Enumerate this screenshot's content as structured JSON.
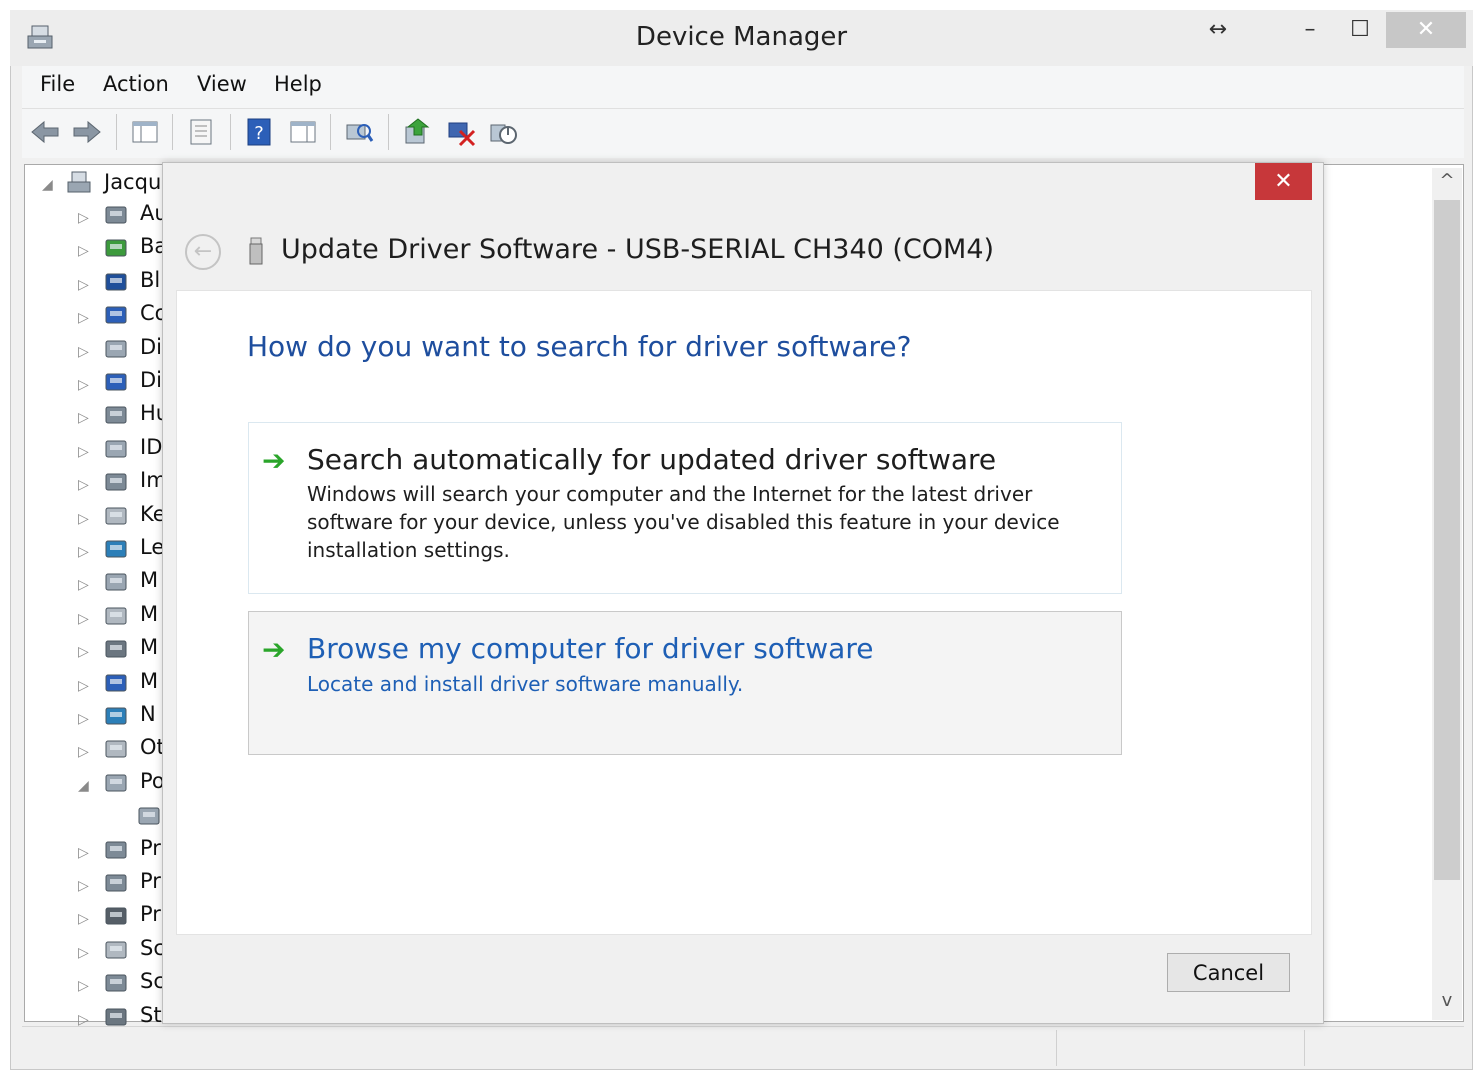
{
  "window": {
    "title": "Device Manager",
    "controls": {
      "resize": "↔",
      "minimize": "–",
      "maximize": "☐",
      "close": "✕"
    }
  },
  "menu": [
    "File",
    "Action",
    "View",
    "Help"
  ],
  "tree": {
    "root": "Jacqu",
    "items": [
      {
        "label": "Au",
        "icon": "speaker-icon",
        "expanded": false
      },
      {
        "label": "Ba",
        "icon": "battery-icon",
        "expanded": false
      },
      {
        "label": "Bl",
        "icon": "bluetooth-icon",
        "expanded": false
      },
      {
        "label": "Co",
        "icon": "computer-icon",
        "expanded": false
      },
      {
        "label": "Di",
        "icon": "disk-drive-icon",
        "expanded": false
      },
      {
        "label": "Di",
        "icon": "display-adapter-icon",
        "expanded": false
      },
      {
        "label": "Hu",
        "icon": "hid-icon",
        "expanded": false
      },
      {
        "label": "ID",
        "icon": "ide-controller-icon",
        "expanded": false
      },
      {
        "label": "Im",
        "icon": "imaging-device-icon",
        "expanded": false
      },
      {
        "label": "Ke",
        "icon": "keyboard-icon",
        "expanded": false
      },
      {
        "label": "Le",
        "icon": "network-legacy-icon",
        "expanded": false
      },
      {
        "label": "M",
        "icon": "memory-device-icon",
        "expanded": false
      },
      {
        "label": "M",
        "icon": "mouse-icon",
        "expanded": false
      },
      {
        "label": "M",
        "icon": "microphone-icon",
        "expanded": false
      },
      {
        "label": "M",
        "icon": "monitor-icon",
        "expanded": false
      },
      {
        "label": "N",
        "icon": "network-adapter-icon",
        "expanded": false
      },
      {
        "label": "Ot",
        "icon": "other-device-icon",
        "expanded": false
      },
      {
        "label": "Po",
        "icon": "ports-icon",
        "expanded": true
      },
      {
        "label": "",
        "icon": "port-child-icon",
        "expanded": null
      },
      {
        "label": "Pr",
        "icon": "printer-icon",
        "expanded": false
      },
      {
        "label": "Pr",
        "icon": "print-queue-icon",
        "expanded": false
      },
      {
        "label": "Pr",
        "icon": "processor-icon",
        "expanded": false
      },
      {
        "label": "Sc",
        "icon": "usb-device-icon",
        "expanded": false
      },
      {
        "label": "Sc",
        "icon": "sound-icon",
        "expanded": false
      },
      {
        "label": "St",
        "icon": "storage-icon",
        "expanded": false
      }
    ]
  },
  "dialog": {
    "close": "✕",
    "back": "←",
    "title": "Update Driver Software - USB-SERIAL CH340 (COM4)",
    "question": "How do you want to search for driver software?",
    "options": {
      "auto": {
        "arrow": "➔",
        "title": "Search automatically for updated driver software",
        "desc": "Windows will search your computer and the Internet for the latest driver software for your device, unless you've disabled this feature in your device installation settings."
      },
      "browse": {
        "arrow": "➔",
        "title": "Browse my computer for driver software",
        "desc": "Locate and install driver software manually."
      }
    },
    "cancel": "Cancel"
  },
  "scrollbar": {
    "up": "^",
    "down": "v"
  },
  "colors": {
    "link_blue": "#1e5fb5",
    "heading_blue": "#1e4e9e",
    "green_arrow": "#2aa52a",
    "close_red": "#c7373a"
  }
}
